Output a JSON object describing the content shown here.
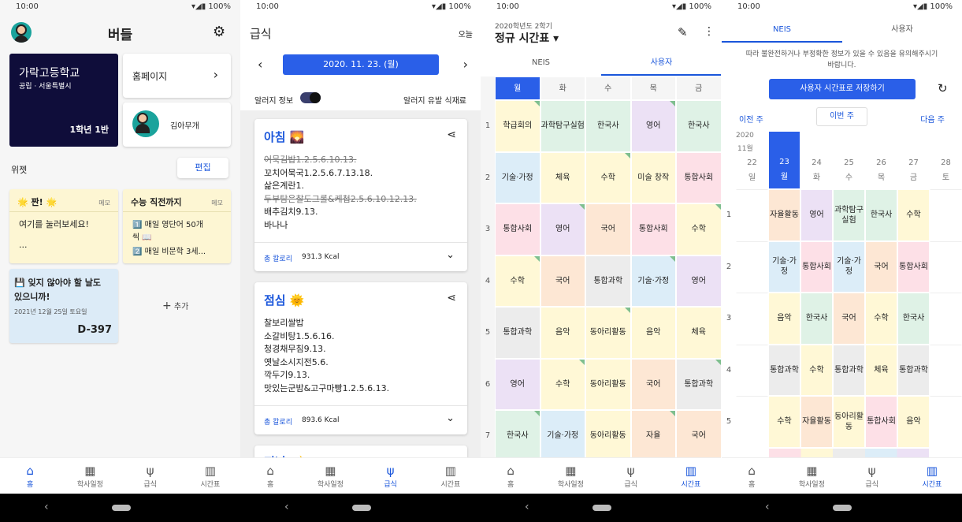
{
  "status": {
    "time": "10:00",
    "battery": "100%",
    "icons": "▾◢▮"
  },
  "nav": [
    {
      "icon": "⌂",
      "label": "홈"
    },
    {
      "icon": "▦",
      "label": "학사일정"
    },
    {
      "icon": "ψ",
      "label": "급식"
    },
    {
      "icon": "▥",
      "label": "시간표"
    }
  ],
  "home": {
    "title": "버들",
    "school": {
      "name": "가락고등학교",
      "sub": "공립 · 서울특별시",
      "grade": "1학년 1반"
    },
    "homepage": "홈페이지",
    "user": "김아무개",
    "widget_label": "위젯",
    "edit": "편집",
    "memo1": {
      "title": "🌟 짠! 🌟",
      "tag": "메모",
      "body1": "여기를 눌러보세요!",
      "body2": "..."
    },
    "memo2": {
      "title": "수능 직전까지",
      "tag": "메모",
      "line1": "1️⃣ 매일 영단어 50개",
      "line2": "씩 📖",
      "line3": "2️⃣ 매일 비문학 3세..."
    },
    "dday": {
      "title1": "💾 잊지 않아야 할 날도",
      "title2": "있으니까!",
      "date": "2021년 12월 25일 토요일",
      "count": "D-397"
    },
    "add": "추가"
  },
  "meal": {
    "title": "급식",
    "today": "오늘",
    "date": "2020. 11. 23. (월)",
    "allergy": "알러지 정보",
    "allergy_food": "알러지 유발 식재료",
    "breakfast": {
      "title": "아침 🌄",
      "items": [
        "어묵김밥1.2.5.6.10.13.",
        "꼬치어묵국1.2.5.6.7.13.18.",
        "삶은계란1.",
        "두부탐은찰도그롤&케첩2.5.6.10.12.13.",
        "배추김치9.13.",
        "바나나"
      ],
      "cal_label": "총 칼로리",
      "cal": "931.3 Kcal"
    },
    "lunch": {
      "title": "점심 🌞",
      "items": [
        "찰보리쌀밥",
        "소갈비탕1.5.6.16.",
        "청경채무침9.13.",
        "옛날소시지전5.6.",
        "깍두기9.13.",
        "맛있는군밤&고구마빵1.2.5.6.13."
      ],
      "cal_label": "총 칼로리",
      "cal": "893.6 Kcal"
    },
    "dinner": {
      "title": "저녁 🌙"
    }
  },
  "timetable": {
    "semester": "2020학년도 2학기",
    "title": "정규 시간표 ▾",
    "tabs": [
      "NEIS",
      "사용자"
    ],
    "days": [
      "월",
      "화",
      "수",
      "목",
      "금"
    ],
    "periods": [
      "1",
      "2",
      "3",
      "4",
      "5",
      "6",
      "7"
    ],
    "rows": [
      [
        "학급회의",
        "과학탐구실험",
        "한국사",
        "영어",
        "한국사"
      ],
      [
        "기술·가정",
        "체육",
        "수학",
        "미술 창작",
        "통합사회"
      ],
      [
        "통합사회",
        "영어",
        "국어",
        "통합사회",
        "수학"
      ],
      [
        "수학",
        "국어",
        "통합과학",
        "기술·가정",
        "영어"
      ],
      [
        "통합과학",
        "음악",
        "동아리활동",
        "음악",
        "체육"
      ],
      [
        "영어",
        "수학",
        "동아리활동",
        "국어",
        "통합과학"
      ],
      [
        "한국사",
        "기술·가정",
        "동아리활동",
        "자율",
        "국어"
      ]
    ]
  },
  "neis": {
    "tabs": [
      "NEIS",
      "사용자"
    ],
    "notice1": "따라 불완전하거나 부정확한 정보가 있을 수 있음을 유의해주시기",
    "notice2": "바랍니다.",
    "save": "사용자 시간표로 저장하기",
    "prev": "이전 주",
    "this": "이번 주",
    "next": "다음 주",
    "year": "2020",
    "month": "11월",
    "dates": [
      "22",
      "23",
      "24",
      "25",
      "26",
      "27",
      "28"
    ],
    "weekdays": [
      "일",
      "월",
      "화",
      "수",
      "목",
      "금",
      "토"
    ],
    "periods": [
      "1",
      "2",
      "3",
      "4",
      "5"
    ],
    "rows": [
      [
        "자율활동",
        "영어",
        "과학탐구\n실험",
        "한국사",
        "수학"
      ],
      [
        "기술·가정",
        "통합사회",
        "기술·가정",
        "국어",
        "통합사회"
      ],
      [
        "음악",
        "한국사",
        "국어",
        "수학",
        "한국사"
      ],
      [
        "통합과학",
        "수학",
        "통합과학",
        "체육",
        "통합과학"
      ],
      [
        "수학",
        "자율활동",
        "동아리활\n동",
        "통합사회",
        "음악"
      ]
    ]
  }
}
